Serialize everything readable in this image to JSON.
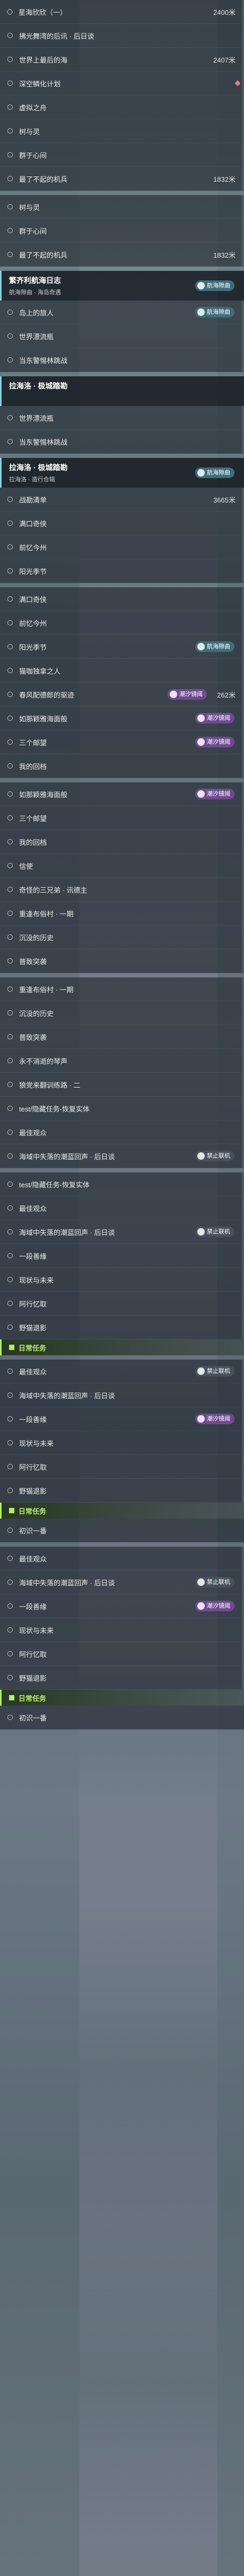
{
  "blocks": [
    {
      "rows": [
        {
          "label": "星海欣欣（一）",
          "dist": "2400米",
          "diamond": true
        },
        {
          "label": "拂光舞湾的后讯 · 后日谈"
        },
        {
          "label": "世界上最后的海",
          "dist": "2407米"
        },
        {
          "label": "深空鳞化计划",
          "pin": true
        },
        {
          "label": "虚拟之舟"
        },
        {
          "label": "树与灵"
        },
        {
          "label": "群于心间"
        },
        {
          "label": "最了不起的机兵",
          "dist": "1832米"
        }
      ]
    },
    {
      "rows": [
        {
          "label": "树与灵"
        },
        {
          "label": "群于心间"
        },
        {
          "label": "最了不起的机兵",
          "dist": "1832米"
        }
      ]
    },
    {
      "header": {
        "title": "繁齐利航海日志",
        "subtitle": "航海隙曲 · 海岛奇遇",
        "badge": "航海隙曲",
        "color": "teal"
      },
      "rows": [
        {
          "label": "岛上的旅人",
          "badge": "航海隙曲",
          "color": "teal"
        },
        {
          "label": "世界漂流瓶"
        },
        {
          "label": "当东警惕林跳战"
        }
      ]
    },
    {
      "header": {
        "title": "拉海洛 · 极城踏勘",
        "subtitle": "",
        "badge": "",
        "color": ""
      },
      "rows": [
        {
          "label": "世界漂流瓶"
        },
        {
          "label": "当东警惕林跳战"
        }
      ]
    },
    {
      "header": {
        "title": "拉海洛 · 极城踏勘",
        "subtitle": "拉海洛 · 造行合辑",
        "badge": "航海隙曲",
        "color": "teal"
      },
      "rows": [
        {
          "label": "战勘清单",
          "dist": "3665米"
        },
        {
          "label": "满口奇侠"
        },
        {
          "label": "前忆今州"
        },
        {
          "label": "阳光季节"
        }
      ]
    },
    {
      "rows": [
        {
          "label": "满口奇侠"
        },
        {
          "label": "前忆今州"
        },
        {
          "label": "阳光季节",
          "badge": "航海隙曲",
          "color": "teal"
        },
        {
          "label": "猫咖独拿之人"
        },
        {
          "label": "春风配德郎的驱迹",
          "badge": "潮汐镜阈",
          "color": "purple",
          "dist": "262米"
        },
        {
          "label": "如那颖雅海面般",
          "badge": "潮汐镜阈",
          "color": "purple"
        },
        {
          "label": "三个邮望",
          "badge": "潮汐镜阈",
          "color": "purple"
        },
        {
          "label": "我的回档"
        }
      ]
    },
    {
      "rows": [
        {
          "label": "如那颖雅海面般",
          "badge": "潮汐镜阈",
          "color": "purple"
        },
        {
          "label": "三个邮望"
        },
        {
          "label": "我的回档"
        },
        {
          "label": "信使"
        },
        {
          "label": "奇怪的三兄弟 · 讯德主"
        },
        {
          "label": "重逢布俗村 · 一期"
        },
        {
          "label": "沉没的历史"
        },
        {
          "label": "普致突袭"
        }
      ]
    },
    {
      "rows": [
        {
          "label": "重逢布俗村 · 一期"
        },
        {
          "label": "沉没的历史"
        },
        {
          "label": "普致突袭"
        },
        {
          "label": "永不消逝的琴声"
        },
        {
          "label": "狼党来翻训练路 · 二"
        },
        {
          "label": "test/隐藏任务-恢复实体"
        },
        {
          "label": "最佳观众"
        },
        {
          "label": "海域中失落的潮蓝回声 · 后日谈",
          "badge": "禁止联机",
          "color": "gray"
        }
      ]
    },
    {
      "rows": [
        {
          "label": "test/隐藏任务-恢复实体"
        },
        {
          "label": "最佳观众"
        },
        {
          "label": "海域中失落的潮蓝回声 · 后日谈",
          "badge": "禁止联机",
          "color": "gray"
        },
        {
          "label": "一段善缘"
        },
        {
          "label": "现状与未来"
        },
        {
          "label": "阿行忆取"
        },
        {
          "label": "野猫退影"
        }
      ],
      "section": "日常任务"
    },
    {
      "rows": [
        {
          "label": "最佳观众",
          "badge": "禁止联机",
          "color": "gray"
        },
        {
          "label": "海域中失落的潮蓝回声 · 后日谈"
        },
        {
          "label": "一段善缘",
          "badge": "潮汐镜阈",
          "color": "purple"
        },
        {
          "label": "现状与未来"
        },
        {
          "label": "阿行忆取"
        },
        {
          "label": "野猫退影"
        }
      ],
      "section": "日常任务",
      "tail": "初识一番"
    },
    {
      "rows": [
        {
          "label": "最佳观众"
        },
        {
          "label": "海域中失落的潮蓝回声 · 后日谈",
          "badge": "禁止联机",
          "color": "gray"
        },
        {
          "label": "一段善缘",
          "badge": "潮汐镜阈",
          "color": "purple"
        },
        {
          "label": "现状与未来"
        },
        {
          "label": "阿行忆取"
        },
        {
          "label": "野猫退影"
        }
      ],
      "section": "日常任务",
      "tail": "初识一番"
    }
  ]
}
